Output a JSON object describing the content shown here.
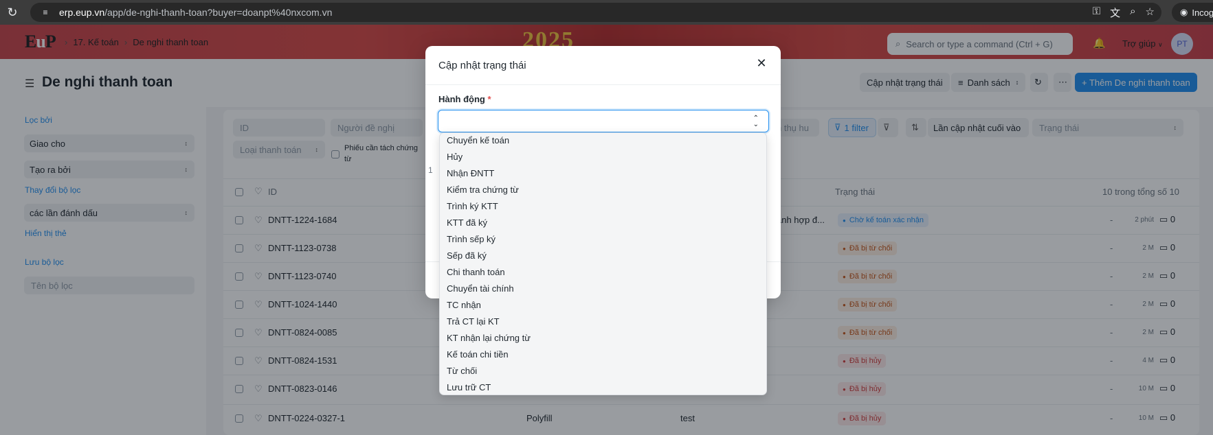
{
  "browser": {
    "url_host": "erp.eup.vn",
    "url_path": "/app/de-nghi-thanh-toan?buyer=doanpt%40nxcom.vn",
    "incognito_label": "Incog"
  },
  "navbar": {
    "logo": "EuP",
    "breadcrumbs": [
      "17. Kế toán",
      "De nghi thanh toan"
    ],
    "banner_text": "2025",
    "search_placeholder": "Search or type a command (Ctrl + G)",
    "help_label": "Trợ giúp",
    "avatar_initials": "PT"
  },
  "page": {
    "title": "De nghi thanh toan",
    "buttons": {
      "update_status": "Cập nhật trạng thái",
      "list_view": "Danh sách",
      "add_new": "+ Thêm De nghi thanh toan"
    }
  },
  "sidebar": {
    "filter_by_label": "Lọc bởi",
    "assigned_to": "Giao cho",
    "created_by": "Tạo ra bởi",
    "change_filter_label": "Thay đổi bộ lọc",
    "tags_select": "các lần đánh dấu",
    "show_tags": "Hiển thị thẻ",
    "save_filter_label": "Lưu bộ lọc",
    "filter_name_placeholder": "Tên bộ lọc"
  },
  "list": {
    "filters": {
      "id_placeholder": "ID",
      "requester_placeholder": "Người đề nghị",
      "payment_type_placeholder": "Loại thanh toán",
      "split_voucher_label": "Phiếu cần tách chứng từ",
      "receiver_placeholder": "n thụ hu",
      "filter_count": "1 filter",
      "sort_label": "Lần cập nhật cuối vào",
      "status_placeholder": "Trạng thái"
    },
    "columns": {
      "id": "ID",
      "status": "Trạng thái",
      "count": "10 trong tổng số 10"
    },
    "rows": [
      {
        "id": "DNTT-1224-1684",
        "col1": "",
        "col2": "",
        "col3": "ành hợp đ...",
        "status": "Chờ kế toán xác nhận",
        "status_color": "blue",
        "dash": "-",
        "time": "2 phút",
        "comments": "0"
      },
      {
        "id": "DNTT-1123-0738",
        "col1": "",
        "col2": "",
        "col3": "",
        "status": "Đã bị từ chối",
        "status_color": "orange",
        "dash": "-",
        "time": "2 M",
        "comments": "0"
      },
      {
        "id": "DNTT-1123-0740",
        "col1": "",
        "col2": "",
        "col3": "",
        "status": "Đã bị từ chối",
        "status_color": "orange",
        "dash": "-",
        "time": "2 M",
        "comments": "0"
      },
      {
        "id": "DNTT-1024-1440",
        "col1": "",
        "col2": "",
        "col3": "",
        "status": "Đã bị từ chối",
        "status_color": "orange",
        "dash": "-",
        "time": "2 M",
        "comments": "0"
      },
      {
        "id": "DNTT-0824-0085",
        "col1": "",
        "col2": "",
        "col3": "",
        "status": "Đã bị từ chối",
        "status_color": "orange",
        "dash": "-",
        "time": "2 M",
        "comments": "0"
      },
      {
        "id": "DNTT-0824-1531",
        "col1": "",
        "col2": "",
        "col3": "",
        "status": "Đã bị hủy",
        "status_color": "red",
        "dash": "-",
        "time": "4 M",
        "comments": "0"
      },
      {
        "id": "DNTT-0823-0146",
        "col1": "",
        "col2": "",
        "col3": "",
        "status": "Đã bị hủy",
        "status_color": "red",
        "dash": "-",
        "time": "10 M",
        "comments": "0"
      },
      {
        "id": "DNTT-0224-0327-1",
        "col1": "Polyfill",
        "col2": "test",
        "col3": "",
        "status": "Đã bị hủy",
        "status_color": "red",
        "dash": "-",
        "time": "10 M",
        "comments": "0"
      }
    ]
  },
  "modal": {
    "title": "Cập nhật trạng thái",
    "field_label": "Hành động",
    "required_mark": "*",
    "selected_value": "",
    "left_mark": "1",
    "options": [
      "Chuyển kế toán",
      "Hủy",
      "Nhận ĐNTT",
      "Kiểm tra chứng từ",
      "Trình ký KTT",
      "KTT đã ký",
      "Trình sếp ký",
      "Sếp đã ký",
      "Chi thanh toán",
      "Chuyển tài chính",
      "TC nhận",
      "Trả CT lại KT",
      "KT nhận lại chứng từ",
      "Kế toán chi tiền",
      "Từ chối",
      "Lưu trữ CT"
    ]
  },
  "colors": {
    "primary": "#2490ef",
    "overlay": "rgba(12,20,28,0.42)",
    "required": "#e24c4c"
  }
}
